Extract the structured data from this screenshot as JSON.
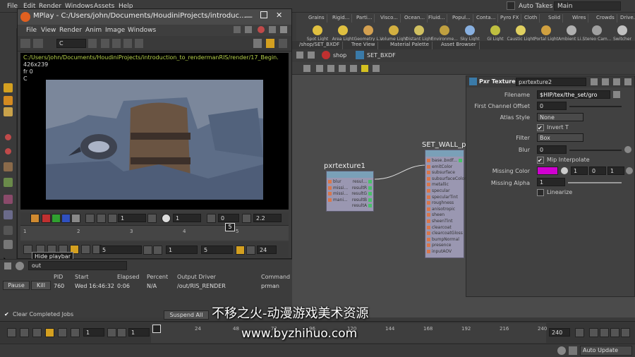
{
  "menubar": {
    "items": [
      "File",
      "Edit",
      "Render",
      "Windows",
      "Assets",
      "Help"
    ],
    "auto_takes": "Auto Takes",
    "desktop": "Main"
  },
  "shelf": {
    "tabs": [
      "Grains",
      "Rigid...",
      "Parti...",
      "Visco...",
      "Ocean...",
      "Fluid...",
      "Popul...",
      "Conta...",
      "Pyro FX",
      "Cloth",
      "Solid",
      "Wires",
      "Crowds",
      "Drive..."
    ],
    "tools": [
      "Spot Light",
      "Area Light",
      "Geometry L...",
      "Volume Light",
      "Distant Light",
      "Environme...",
      "Sky Light",
      "GI Light",
      "Caustic Light",
      "Portal Light",
      "Ambient Li...",
      "Stereo Cam...",
      "Switcher"
    ]
  },
  "mplay": {
    "title": "MPlay - C:/Users/john/Documents/HoudiniProjects/introduc...",
    "menu": [
      "File",
      "View",
      "Render",
      "Anim",
      "Image",
      "Windows"
    ],
    "channel": "C",
    "path": "C:/Users/john/Documents/HoudiniProjects/introduction_to_rendermanRIS/render/17_Begin.",
    "resolution": "426x239",
    "frame_info": "fr 0",
    "channel_info": "C",
    "ctrl_values": [
      "1",
      "1",
      "0",
      "2.2"
    ],
    "timeline_ticks": [
      "1",
      "2",
      "3",
      "4",
      "5"
    ],
    "current_frame": "5",
    "tooltip": "Hide playbar",
    "start_frame": "5",
    "range_start": "1",
    "range_end": "5",
    "fps": "24"
  },
  "jobs": {
    "out_label": "out",
    "columns": [
      "PID",
      "Start",
      "Elapsed",
      "Percent",
      "Output Driver",
      "Command"
    ],
    "row": {
      "pid": "760",
      "start": "Wed 16:46:32",
      "elapsed": "0:06",
      "percent": "N/A",
      "driver": "/out/RIS_RENDER",
      "command": "prman"
    },
    "pause": "Pause",
    "kill": "Kill",
    "clear": "Clear Completed Jobs",
    "suspend": "Suspend All"
  },
  "network": {
    "tabs": [
      "/shop/SET_BXDF",
      "Tree View",
      "Material Palette",
      "Asset Browser"
    ],
    "path_root": "shop",
    "path_node": "SET_BXDF",
    "node1": {
      "name": "pxrtexture1",
      "inputs": [
        "blur",
        "missi...",
        "missi...",
        "mani..."
      ],
      "outputs": [
        "resul...",
        "resultR",
        "resultG",
        "resultB",
        "resultA"
      ]
    },
    "node2": {
      "name": "SET_WALL_p",
      "inputs": [
        "base...",
        "emitColor",
        "subsurface",
        "subsurfaceColor",
        "metallic",
        "specular",
        "specularTint",
        "roughness",
        "anisotropic",
        "sheen",
        "sheenTint",
        "clearcoat",
        "clearcoatGloss",
        "bumpNormal",
        "presence",
        "inputAOV"
      ],
      "outputs": [
        "bxdf..."
      ]
    }
  },
  "params": {
    "type": "Pxr Texture",
    "node": "pxrtexture2",
    "filename_label": "Filename",
    "filename": "$HIP/tex/the_set/gro",
    "first_channel_label": "First Channel Offset",
    "first_channel": "0",
    "atlas_label": "Atlas Style",
    "atlas": "None",
    "invert": "Invert T",
    "filter_label": "Filter",
    "filter": "Box",
    "blur_label": "Blur",
    "blur": "0",
    "mip": "Mip Interpolate",
    "missing_color_label": "Missing Color",
    "missing_color": [
      "1",
      "0",
      "1"
    ],
    "missing_color_hex": "#d000d0",
    "missing_alpha_label": "Missing Alpha",
    "missing_alpha": "1",
    "linearize": "Linearize"
  },
  "global_timeline": {
    "frame": "1",
    "start": "1",
    "ticks": [
      "1",
      "24",
      "48",
      "72",
      "96",
      "120",
      "144",
      "168",
      "192",
      "216",
      "240"
    ],
    "end": "240"
  },
  "status": {
    "auto_update": "Auto Update"
  },
  "watermark": {
    "cn": "不移之火-动漫游戏美术资源",
    "url": "www.byzhihuo.com"
  }
}
